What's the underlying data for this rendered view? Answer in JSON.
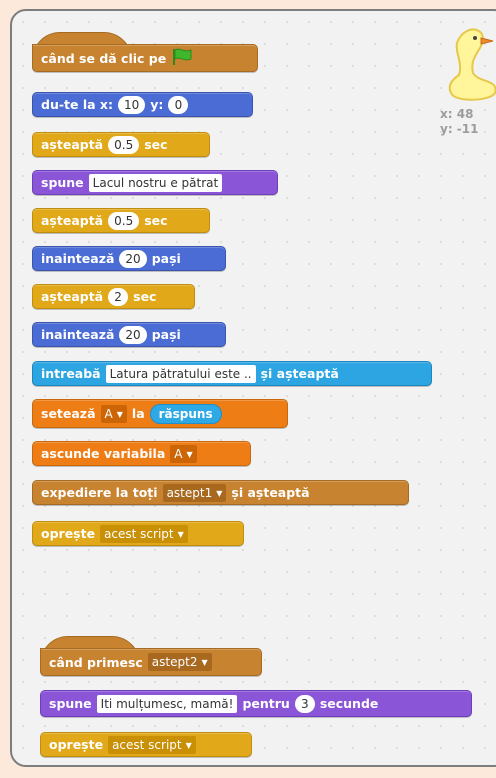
{
  "script1": {
    "hat": {
      "label": "când se dă clic pe"
    },
    "goto": {
      "label": "du-te la x:",
      "x": "10",
      "ylabel": "y:",
      "y": "0"
    },
    "wait1": {
      "label": "așteaptă",
      "value": "0.5",
      "unit": "sec"
    },
    "say": {
      "label": "spune",
      "text": "Lacul nostru e pătrat"
    },
    "wait2": {
      "label": "așteaptă",
      "value": "0.5",
      "unit": "sec"
    },
    "move1": {
      "label": "inaintează",
      "value": "20",
      "unit": "pași"
    },
    "wait3": {
      "label": "așteaptă",
      "value": "2",
      "unit": "sec"
    },
    "move2": {
      "label": "inaintează",
      "value": "20",
      "unit": "pași"
    },
    "ask": {
      "label": "intreabă",
      "text": "Latura pătratului este ..",
      "suffix": "și așteaptă"
    },
    "setvar": {
      "label": "setează",
      "var": "A",
      "to": "la",
      "reporter": "răspuns"
    },
    "hidevar": {
      "label": "ascunde variabila",
      "var": "A"
    },
    "broadcast": {
      "label": "expediere la toți",
      "message": "astept1",
      "suffix": "și așteaptă"
    },
    "stop": {
      "label": "oprește",
      "option": "acest script"
    }
  },
  "script2": {
    "hat": {
      "label": "când primesc",
      "message": "astept2"
    },
    "sayfor": {
      "label": "spune",
      "text": "Iti mulțumesc, mamă!",
      "for": "pentru",
      "secs": "3",
      "unit": "secunde"
    },
    "stop": {
      "label": "oprește",
      "option": "acest script"
    }
  },
  "sprite": {
    "x_label": "x: 48",
    "y_label": "y: -11"
  },
  "colors": {
    "motion": "#4a6cd4",
    "control": "#e1a91a",
    "looks": "#8a55d7",
    "sensing": "#2ca5e2",
    "data": "#ee7d16",
    "events": "#c88330",
    "flag": "#3fb62b"
  }
}
